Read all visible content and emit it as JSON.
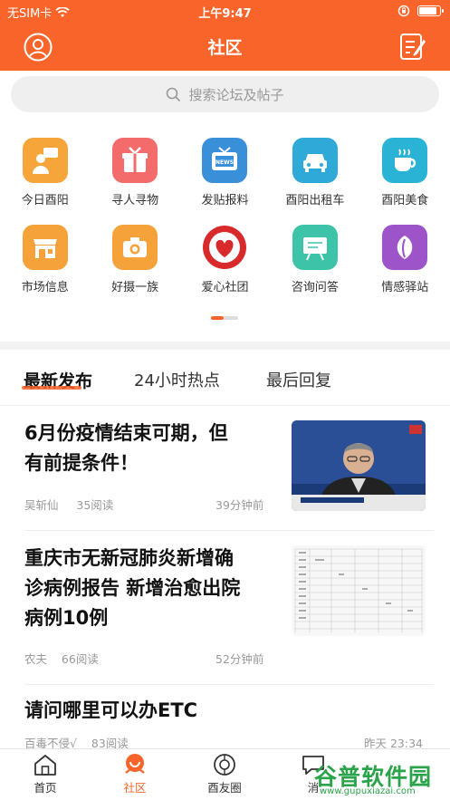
{
  "status": {
    "carrier": "无SIM卡",
    "time": "上午9:47",
    "battery_level": 0.9
  },
  "nav": {
    "title": "社区"
  },
  "search": {
    "placeholder": "搜索论坛及帖子"
  },
  "grid": [
    {
      "label": "今日酉阳",
      "icon": "speech-person-icon",
      "color": "#f5a53a"
    },
    {
      "label": "寻人寻物",
      "icon": "gift-box-icon",
      "color": "#f36b6b"
    },
    {
      "label": "发贴报料",
      "icon": "tv-news-icon",
      "color": "#3a8fd9"
    },
    {
      "label": "酉阳出租车",
      "icon": "taxi-icon",
      "color": "#2ea9d8"
    },
    {
      "label": "酉阳美食",
      "icon": "coffee-cup-icon",
      "color": "#2bb3d6"
    },
    {
      "label": "市场信息",
      "icon": "storefront-icon",
      "color": "#f5a23a"
    },
    {
      "label": "好摄一族",
      "icon": "camera-icon",
      "color": "#f5a23a"
    },
    {
      "label": "爱心社团",
      "icon": "heart-hands-icon",
      "color": "#d82a2a"
    },
    {
      "label": "咨询问答",
      "icon": "qa-board-icon",
      "color": "#3cc3a8"
    },
    {
      "label": "情感驿站",
      "icon": "leaf-icon",
      "color": "#9d54c8"
    }
  ],
  "tabs": [
    {
      "label": "最新发布",
      "active": true
    },
    {
      "label": "24小时热点",
      "active": false
    },
    {
      "label": "最后回复",
      "active": false
    }
  ],
  "articles": [
    {
      "title_lines": [
        "6月份疫情结束可期，但",
        "有前提条件！"
      ],
      "author": "吴斩仙",
      "reads": "35阅读",
      "time": "39分钟前",
      "image": "press-conference"
    },
    {
      "title_lines": [
        "重庆市无新冠肺炎新增确",
        "诊病例报告 新增治愈出院",
        "病例10例"
      ],
      "author": "农夫",
      "reads": "66阅读",
      "time": "52分钟前",
      "image": "data-table"
    },
    {
      "title_lines": [
        "请问哪里可以办ETC"
      ],
      "author": "百毒不侵√",
      "reads": "83阅读",
      "time": "昨天 23:34",
      "image": ""
    }
  ],
  "tabbar": [
    {
      "label": "首页",
      "icon": "home-icon",
      "active": false
    },
    {
      "label": "社区",
      "icon": "community-icon",
      "active": true
    },
    {
      "label": "酉友圈",
      "icon": "friends-circle-icon",
      "active": false
    },
    {
      "label": "消",
      "icon": "message-icon",
      "active": false
    }
  ],
  "watermark": {
    "text": "谷普软件园",
    "url": "www.gupuxiazai.com"
  },
  "colors": {
    "brand": "#f8642a",
    "muted": "#999999"
  }
}
